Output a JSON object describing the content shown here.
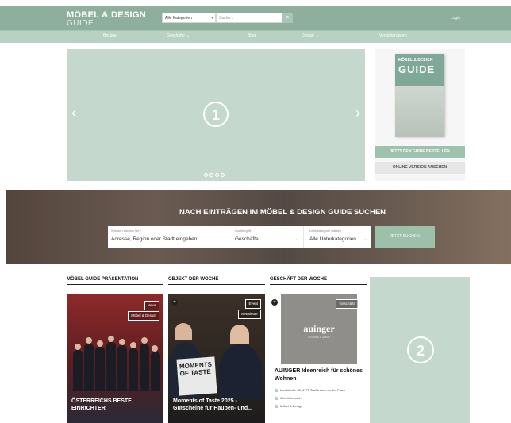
{
  "header": {
    "logo_line1": "MÖBEL & DESIGN",
    "logo_line2": "GUIDE",
    "category_select": "Alle Kategorien",
    "search_placeholder": "Suche...",
    "login": "Login"
  },
  "nav": {
    "items": [
      "Bezüge",
      "Geschäfte",
      "Blog",
      "Design",
      "Versicherungen"
    ]
  },
  "carousel": {
    "slide_number": "1",
    "prev": "‹",
    "next": "›"
  },
  "promo": {
    "mag_small": "MÖBEL & DESIGN",
    "mag_big": "GUIDE",
    "order_button": "JETZT DEN GUIDE BESTELLEN",
    "online_button": "ONLINE VERSION ANSEHEN"
  },
  "hero": {
    "title": "NACH EINTRÄGEN IM MÖBEL & DESIGN GUIDE SUCHEN",
    "field1_label": "Wonach suchen Sie?",
    "field1_value": "Adresse, Region oder Stadt eingeben...",
    "field2_label": "Suchbegriff",
    "field2_value": "Geschäfte",
    "field3_label": "Unterkategorie wählen",
    "field3_value": "Alle Unterkategorien",
    "search_button": "JETZT SUCHEN"
  },
  "sections": {
    "col1_heading": "MÖBEL GUIDE PRÄSENTATION",
    "col2_heading": "OBJEKT DER WOCHE",
    "col3_heading": "GESCHÄFT DER WOCHE"
  },
  "card1": {
    "tag1": "News",
    "tag2": "Möbel & Design",
    "title": "ÖSTERREICHS BESTE EINRICHTER"
  },
  "card2": {
    "tag1": "Event",
    "tag2": "Newsletter",
    "cover_text": "MOMENTS OF TASTE",
    "title": "Moments of Taste 2025 - Gutscheine für Hauben- und..."
  },
  "card3": {
    "tag": "Geschäfte",
    "brand": "auinger",
    "brand_sub": "WOHNEN & LEBEN",
    "title": "AUINGER Ideenreich für schönes Wohnen",
    "line1": "Landstraße 35, 4771 Taufkirchen an der Pram",
    "line2": "Oberösterreich",
    "line3": "Möbel & Design"
  },
  "ad": {
    "number": "2"
  },
  "colors": {
    "brand_green": "#8eaf9d",
    "light_green": "#c4d8cd"
  }
}
